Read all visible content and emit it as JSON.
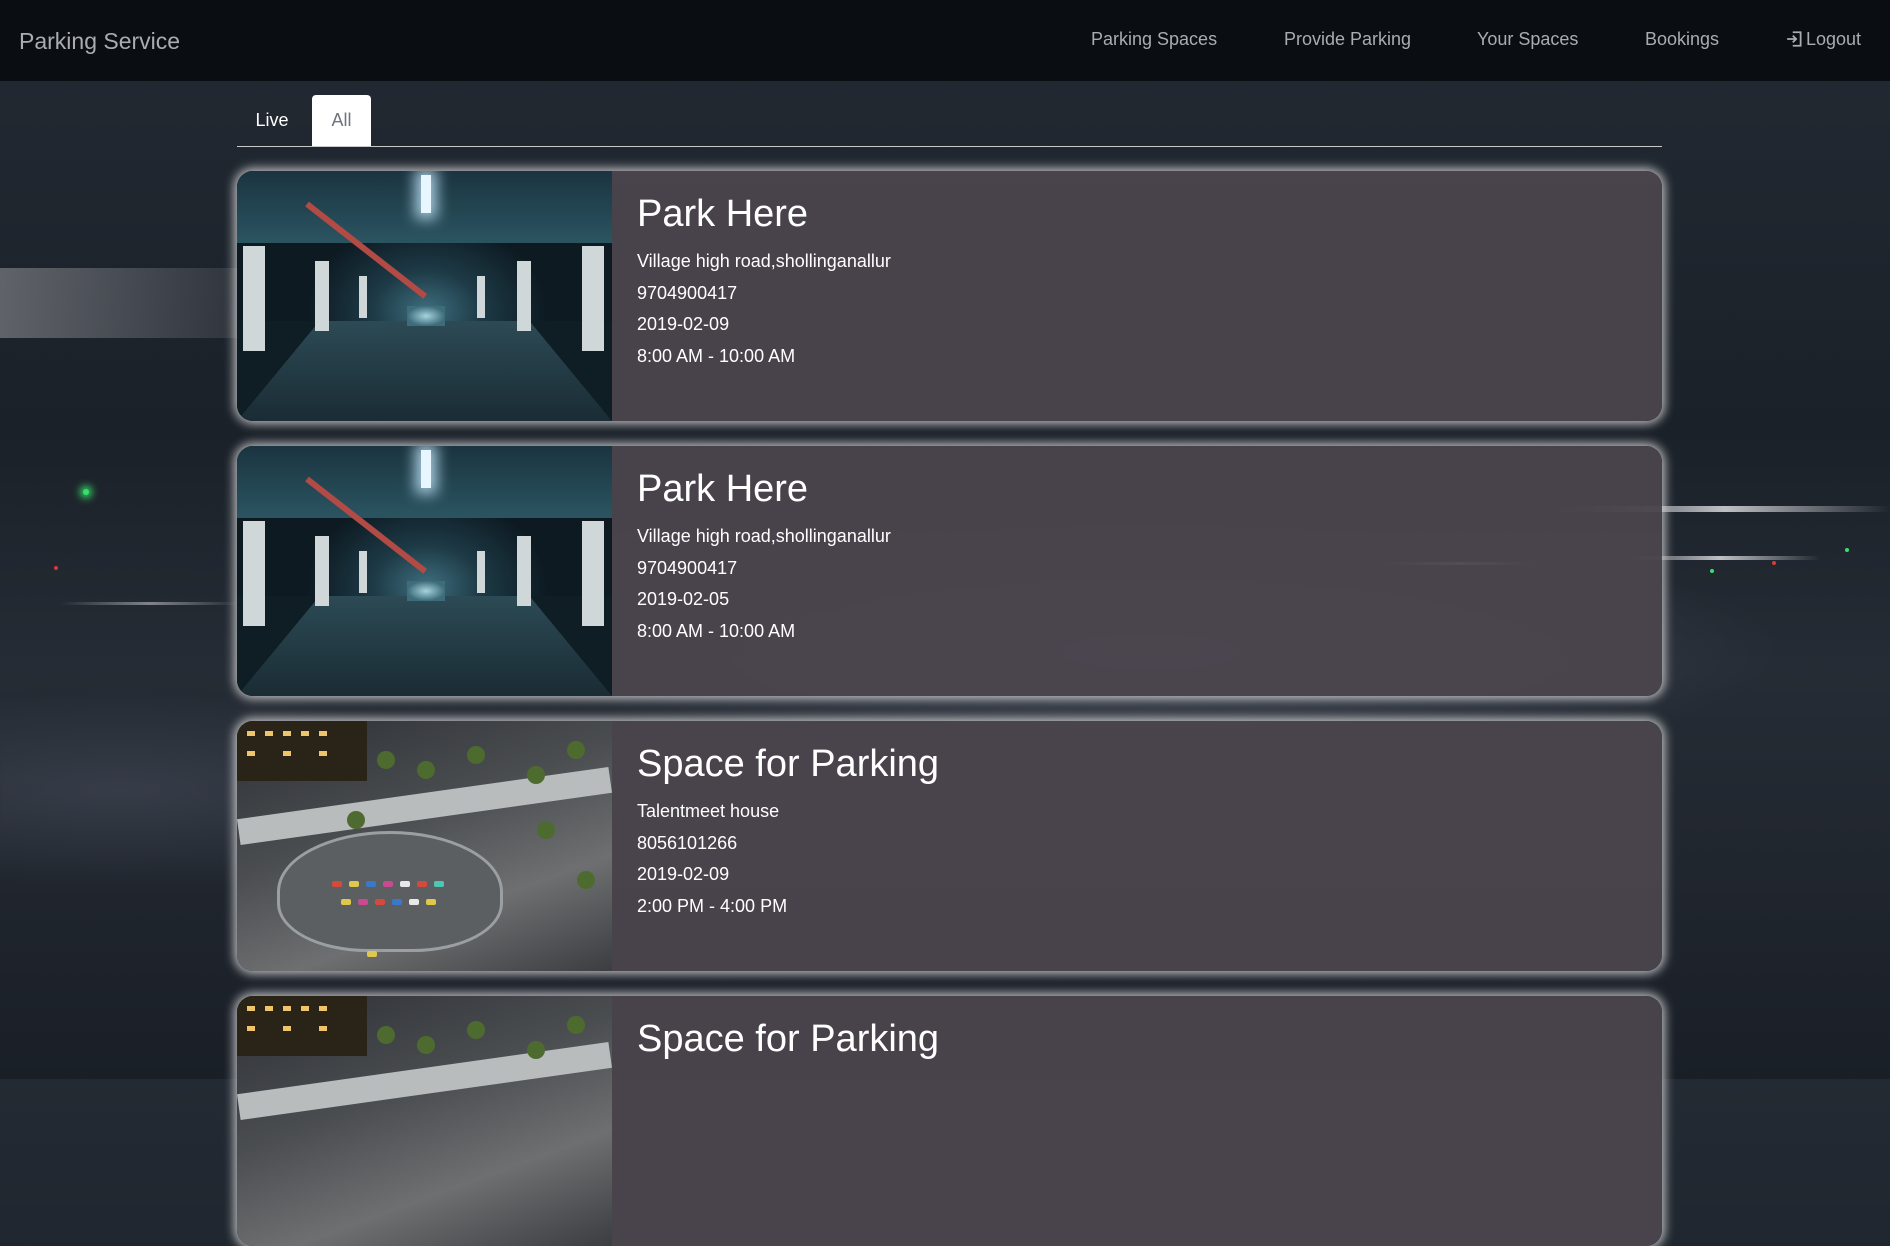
{
  "app": {
    "brand": "Parking Service"
  },
  "navbar": {
    "items": [
      {
        "label": "Parking Spaces",
        "icon": ""
      },
      {
        "label": "Provide Parking",
        "icon": ""
      },
      {
        "label": "Your Spaces",
        "icon": ""
      },
      {
        "label": "Bookings",
        "icon": ""
      },
      {
        "label": "Logout",
        "icon": "logout-icon"
      }
    ]
  },
  "tabs": {
    "items": [
      {
        "label": "Live",
        "active": false
      },
      {
        "label": "All",
        "active": true
      }
    ]
  },
  "listings": [
    {
      "title": "Park Here",
      "address": "Village high road,shollinganallur",
      "phone": "9704900417",
      "date": "2019-02-09",
      "time": "8:00 AM - 10:00 AM",
      "image": "underground-garage"
    },
    {
      "title": "Park Here",
      "address": "Village high road,shollinganallur",
      "phone": "9704900417",
      "date": "2019-02-05",
      "time": "8:00 AM - 10:00 AM",
      "image": "underground-garage"
    },
    {
      "title": "Space for Parking",
      "address": "Talentmeet house",
      "phone": "8056101266",
      "date": "2019-02-09",
      "time": "2:00 PM - 4:00 PM",
      "image": "aerial-parking-lot"
    },
    {
      "title": "Space for Parking",
      "address": "",
      "phone": "",
      "date": "",
      "time": "",
      "image": "aerial-parking-lot"
    }
  ],
  "colors": {
    "navbar_bg": "#0a0d12",
    "nav_text": "#a9acb0",
    "card_bg": "#4b454e",
    "card_text": "#ffffff",
    "tab_active_bg": "#ffffff"
  }
}
